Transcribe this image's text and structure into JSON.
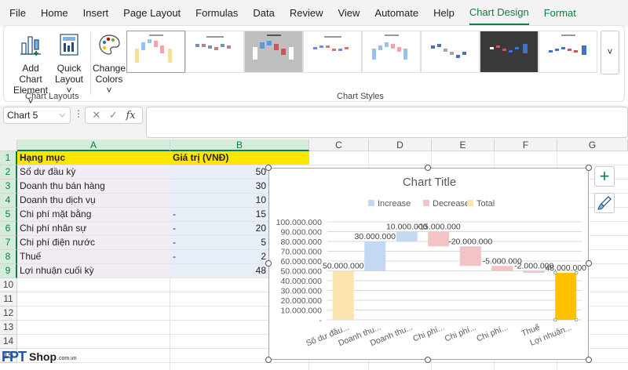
{
  "menu": {
    "items": [
      "File",
      "Home",
      "Insert",
      "Page Layout",
      "Formulas",
      "Data",
      "Review",
      "View",
      "Automate",
      "Help",
      "Chart Design",
      "Format"
    ],
    "active": "Chart Design"
  },
  "ribbon": {
    "add_chart_element_line1": "Add Chart",
    "add_chart_element_line2": "Element ˅",
    "quick_layout_line1": "Quick",
    "quick_layout_line2": "Layout ˅",
    "change_colors_line1": "Change",
    "change_colors_line2": "Colors ˅",
    "group_chart_layouts": "Chart Layouts",
    "group_chart_styles": "Chart Styles",
    "gallery_more": "˅"
  },
  "formula_bar": {
    "name_box": "Chart 5",
    "cancel_icon": "✕",
    "enter_icon": "✓",
    "fx_label": "fx",
    "value": ""
  },
  "sheet": {
    "columns": [
      "A",
      "B",
      "C",
      "D",
      "E",
      "F",
      "G"
    ],
    "rows": [
      "1",
      "2",
      "3",
      "4",
      "5",
      "6",
      "7",
      "8",
      "9",
      "10",
      "11",
      "12",
      "13",
      "14",
      "15"
    ],
    "header": {
      "a": "Hạng mục",
      "b": "Giá trị (VNĐ)"
    },
    "data": [
      {
        "a": "Số dư đầu kỳ",
        "minus": "",
        "b": "50"
      },
      {
        "a": "Doanh thu bán hàng",
        "minus": "",
        "b": "30"
      },
      {
        "a": "Doanh thu dịch vụ",
        "minus": "",
        "b": "10"
      },
      {
        "a": "Chi phí mặt bằng",
        "minus": "-",
        "b": "15"
      },
      {
        "a": "Chi phí nhân sự",
        "minus": "-",
        "b": "20"
      },
      {
        "a": "Chi phí điện nước",
        "minus": "-",
        "b": "5"
      },
      {
        "a": "Thuế",
        "minus": "-",
        "b": "2"
      },
      {
        "a": "Lợi nhuận cuối kỳ",
        "minus": "",
        "b": "48"
      }
    ]
  },
  "chart_data": {
    "type": "bar",
    "subtype": "waterfall",
    "title": "Chart Title",
    "legend": [
      "Increase",
      "Decrease",
      "Total"
    ],
    "legend_position": "top",
    "colors": {
      "Increase": "#c5d8f2",
      "Decrease": "#f2c4c4",
      "Total": "#fce4b0",
      "Selected": "#ffc000"
    },
    "categories": [
      "Số dư đầu...",
      "Doanh thu...",
      "Doanh thu...",
      "Chi phí...",
      "Chi phí...",
      "Chi phí...",
      "Thuế",
      "Lợi nhuận..."
    ],
    "values": [
      50000000,
      30000000,
      10000000,
      -15000000,
      -20000000,
      -5000000,
      -2000000,
      48000000
    ],
    "kinds": [
      "Total",
      "Increase",
      "Increase",
      "Decrease",
      "Decrease",
      "Decrease",
      "Decrease",
      "Total"
    ],
    "data_labels": [
      "50.000.000",
      "30.000.000",
      "10.000.000",
      "-15.000.000",
      "-20.000.000",
      "-5.000.000",
      "-2.000.000",
      "48.000.000"
    ],
    "yticks": [
      "-",
      "10.000.000",
      "20.000.000",
      "30.000.000",
      "40.000.000",
      "50.000.000",
      "60.000.000",
      "70.000.000",
      "80.000.000",
      "90.000.000",
      "100.000.000"
    ],
    "ylim": [
      0,
      100000000
    ],
    "grid": true
  },
  "watermark": {
    "brand": "FPT",
    "shop": "Shop",
    "domain": ".com.vn"
  }
}
